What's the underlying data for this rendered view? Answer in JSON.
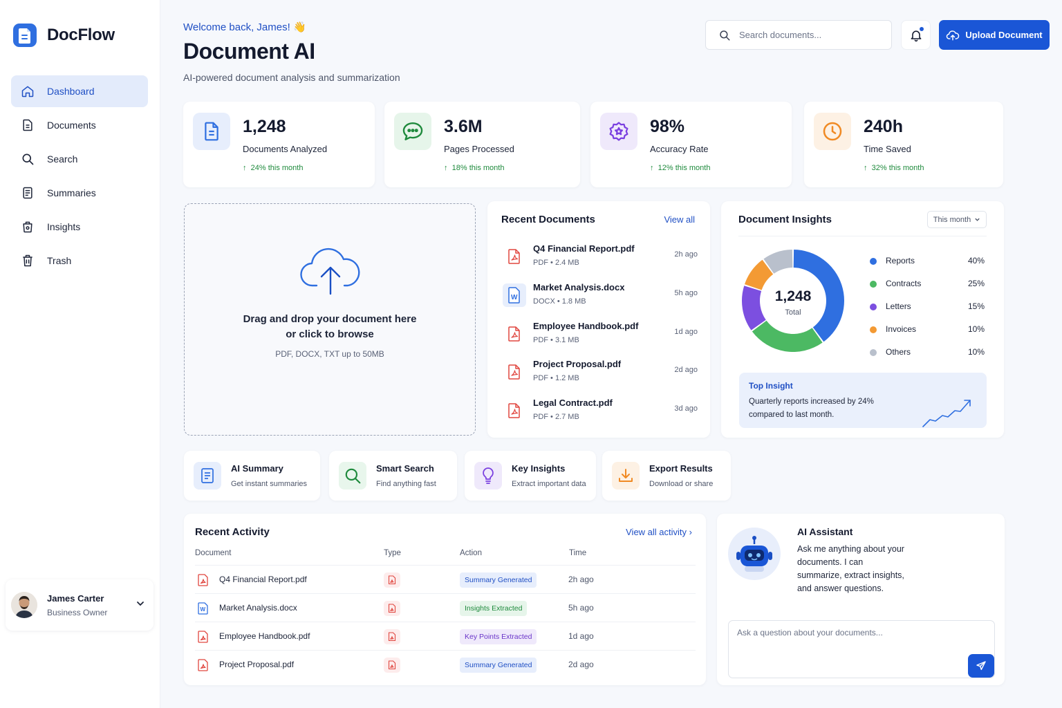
{
  "app": {
    "name": "DocFlow"
  },
  "sidebar": {
    "items": [
      {
        "label": "Dashboard",
        "icon": "home-icon"
      },
      {
        "label": "Documents",
        "icon": "document-icon"
      },
      {
        "label": "Search",
        "icon": "search-icon"
      },
      {
        "label": "Summaries",
        "icon": "summary-icon"
      },
      {
        "label": "Insights",
        "icon": "insights-icon"
      },
      {
        "label": "Trash",
        "icon": "trash-icon"
      }
    ],
    "active": "Dashboard",
    "user": {
      "name": "James Carter",
      "role": "Business Owner"
    }
  },
  "header": {
    "welcome": "Welcome back, James! 👋",
    "title": "Document AI",
    "subtitle": "AI-powered document analysis and summarization",
    "search_placeholder": "Search documents...",
    "upload_label": "Upload Document"
  },
  "stats": [
    {
      "value": "1,248",
      "label": "Documents Analyzed",
      "delta": "24% this month",
      "color": "#2f6fe0"
    },
    {
      "value": "3.6M",
      "label": "Pages Processed",
      "delta": "18% this month",
      "color": "#1e8a3c"
    },
    {
      "value": "98%",
      "label": "Accuracy Rate",
      "delta": "12% this month",
      "color": "#7a3fe0"
    },
    {
      "value": "240h",
      "label": "Time Saved",
      "delta": "32% this month",
      "color": "#f08a24"
    }
  ],
  "dropzone": {
    "line1": "Drag and drop your document here",
    "line2": "or click to browse",
    "hint": "PDF, DOCX, TXT up to 50MB"
  },
  "recent_documents": {
    "title": "Recent Documents",
    "view_all": "View all",
    "items": [
      {
        "name": "Q4 Financial Report.pdf",
        "meta": "PDF • 2.4 MB",
        "time": "2h ago",
        "kind": "pdf"
      },
      {
        "name": "Market Analysis.docx",
        "meta": "DOCX • 1.8 MB",
        "time": "5h ago",
        "kind": "docx"
      },
      {
        "name": "Employee Handbook.pdf",
        "meta": "PDF • 3.1 MB",
        "time": "1d ago",
        "kind": "pdf"
      },
      {
        "name": "Project Proposal.pdf",
        "meta": "PDF • 1.2 MB",
        "time": "2d ago",
        "kind": "pdf"
      },
      {
        "name": "Legal Contract.pdf",
        "meta": "PDF • 2.7 MB",
        "time": "3d ago",
        "kind": "pdf"
      }
    ]
  },
  "insights": {
    "title": "Document Insights",
    "period": "This month",
    "total_value": "1,248",
    "total_label": "Total",
    "legend": [
      {
        "label": "Reports",
        "value": "40%",
        "color": "#2f6fe0"
      },
      {
        "label": "Contracts",
        "value": "25%",
        "color": "#4cb963"
      },
      {
        "label": "Letters",
        "value": "15%",
        "color": "#7c4fe0"
      },
      {
        "label": "Invoices",
        "value": "10%",
        "color": "#f39a34"
      },
      {
        "label": "Others",
        "value": "10%",
        "color": "#b9c0cc"
      }
    ],
    "top_insight_title": "Top Insight",
    "top_insight_text": "Quarterly reports increased by 24% compared to last month."
  },
  "chart_data": {
    "type": "pie",
    "categories": [
      "Reports",
      "Contracts",
      "Letters",
      "Invoices",
      "Others"
    ],
    "values": [
      40,
      25,
      15,
      10,
      10
    ],
    "title": "Document Insights"
  },
  "features": [
    {
      "title": "AI Summary",
      "subtitle": "Get instant summaries",
      "icon": "summary-doc-icon"
    },
    {
      "title": "Smart Search",
      "subtitle": "Find anything fast",
      "icon": "magnifier-icon"
    },
    {
      "title": "Key Insights",
      "subtitle": "Extract important data",
      "icon": "lightbulb-icon"
    },
    {
      "title": "Export Results",
      "subtitle": "Download or share",
      "icon": "download-icon"
    }
  ],
  "activity": {
    "title": "Recent Activity",
    "view_all": "View all activity",
    "columns": [
      "Document",
      "Type",
      "Action",
      "Time"
    ],
    "rows": [
      {
        "document": "Q4 Financial Report.pdf",
        "kind": "pdf",
        "action": "Summary Generated",
        "tone": "blue",
        "time": "2h ago"
      },
      {
        "document": "Market Analysis.docx",
        "kind": "docx",
        "action": "Insights Extracted",
        "tone": "green",
        "time": "5h ago"
      },
      {
        "document": "Employee Handbook.pdf",
        "kind": "pdf",
        "action": "Key Points Extracted",
        "tone": "purple",
        "time": "1d ago"
      },
      {
        "document": "Project Proposal.pdf",
        "kind": "pdf",
        "action": "Summary Generated",
        "tone": "blue",
        "time": "2d ago"
      }
    ]
  },
  "assistant": {
    "title": "AI Assistant",
    "text": "Ask me anything about your documents. I can summarize, extract insights, and answer questions.",
    "placeholder": "Ask a question about your documents..."
  }
}
